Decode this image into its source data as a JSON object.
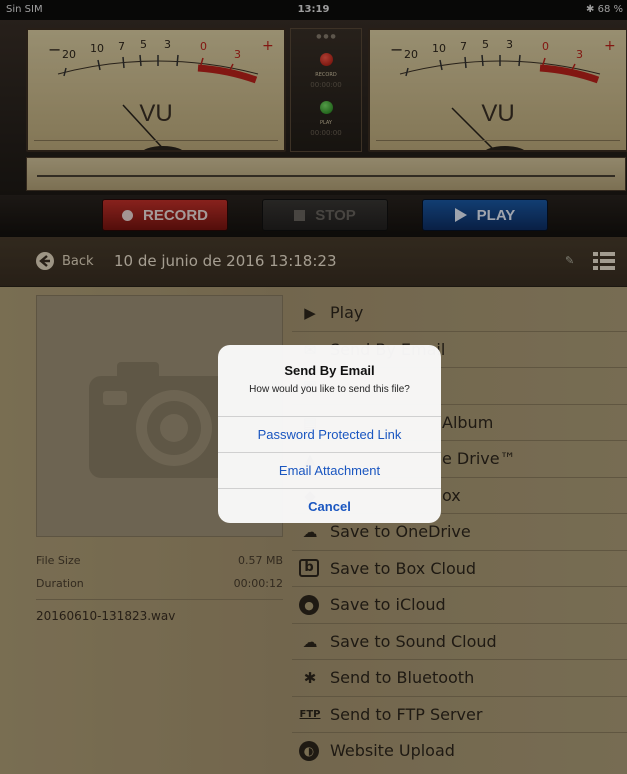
{
  "status_bar": {
    "carrier": "Sin SIM",
    "time": "13:19",
    "battery": "68 %"
  },
  "meters": {
    "left": {
      "label": "VU",
      "scale": [
        "20",
        "10",
        "7",
        "5",
        "3",
        "0",
        "3"
      ],
      "minus": "−",
      "plus": "+"
    },
    "right": {
      "label": "VU",
      "scale": [
        "20",
        "10",
        "7",
        "5",
        "3",
        "0",
        "3"
      ],
      "minus": "−",
      "plus": "+"
    },
    "record_led_label": "RECORD",
    "record_time": "00:00:00",
    "play_led_label": "PLAY",
    "play_time": "00:00:00"
  },
  "transport": {
    "record_label": "RECORD",
    "stop_label": "STOP",
    "play_label": "PLAY"
  },
  "nav": {
    "back_label": "Back",
    "title": "10 de junio de 2016 13:18:23"
  },
  "file_info": {
    "size_label": "File Size",
    "size_value": "0.57 MB",
    "duration_label": "Duration",
    "duration_value": "00:00:12",
    "filename": "20160610-131823.wav"
  },
  "actions": [
    {
      "icon": "play-circle-icon",
      "label": "Play"
    },
    {
      "icon": "mail-icon",
      "label": "Send By Email"
    },
    {
      "icon": "camera-roll-icon",
      "label": ""
    },
    {
      "icon": "album-icon",
      "label": "Album"
    },
    {
      "icon": "drive-icon",
      "label": "e Drive™"
    },
    {
      "icon": "dropbox-icon",
      "label": "ox"
    },
    {
      "icon": "onedrive-icon",
      "label": "Save to OneDrive"
    },
    {
      "icon": "box-icon",
      "label": "Save to Box Cloud"
    },
    {
      "icon": "apple-icon",
      "label": "Save to iCloud"
    },
    {
      "icon": "soundcloud-icon",
      "label": "Save to Sound Cloud"
    },
    {
      "icon": "bluetooth-icon",
      "label": "Send to Bluetooth"
    },
    {
      "icon": "ftp-icon",
      "label": "Send to FTP Server"
    },
    {
      "icon": "globe-icon",
      "label": "Website Upload"
    }
  ],
  "alert": {
    "title": "Send By Email",
    "message": "How would you like to send this file?",
    "option1": "Password Protected Link",
    "option2": "Email Attachment",
    "cancel": "Cancel"
  },
  "colors": {
    "accent_blue": "#1a56c0",
    "record_red": "#c8322b",
    "play_blue": "#1b5ba8"
  }
}
